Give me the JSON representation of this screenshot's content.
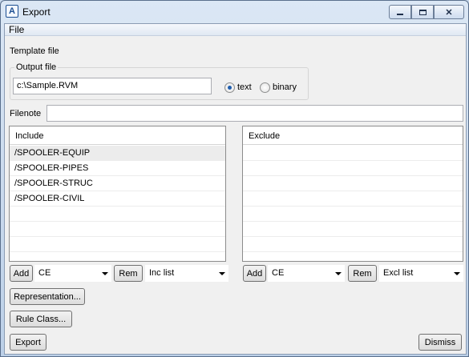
{
  "window": {
    "title": "Export",
    "app_icon": "app-logo-icon",
    "min_icon": "minimize-icon",
    "max_icon": "maximize-icon",
    "close_icon": "close-icon"
  },
  "menu": {
    "file": "File"
  },
  "template_label": "Template file",
  "output": {
    "group_label": "Output file",
    "path": "c:\\Sample.RVM",
    "radio_text": "text",
    "radio_binary": "binary",
    "selected": "text"
  },
  "filenote": {
    "label": "Filenote",
    "value": ""
  },
  "include": {
    "header": "Include",
    "items": [
      "/SPOOLER-EQUIP",
      "/SPOOLER-PIPES",
      "/SPOOLER-STRUC",
      "/SPOOLER-CIVIL"
    ],
    "add_label": "Add",
    "combo1": "CE",
    "rem_label": "Rem",
    "combo2": "Inc list"
  },
  "exclude": {
    "header": "Exclude",
    "items": [],
    "add_label": "Add",
    "combo1": "CE",
    "rem_label": "Rem",
    "combo2": "Excl list"
  },
  "buttons": {
    "representation": "Representation...",
    "rule_class": "Rule Class...",
    "export": "Export",
    "dismiss": "Dismiss"
  }
}
